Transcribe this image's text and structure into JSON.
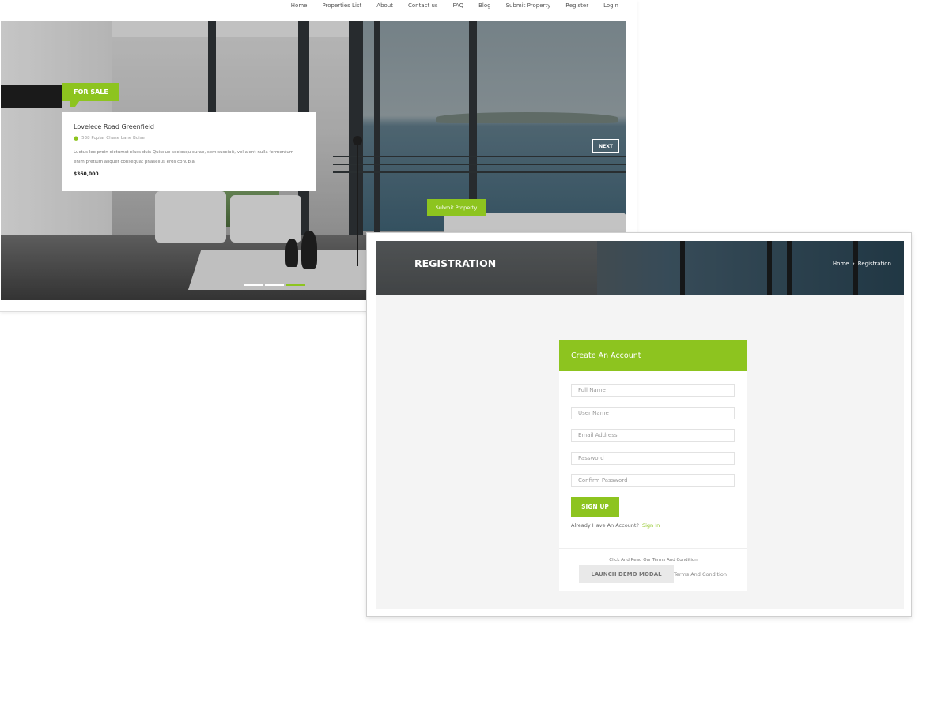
{
  "home": {
    "nav": [
      "Home",
      "Properties List",
      "About",
      "Contact us",
      "FAQ",
      "Blog",
      "Submit Property",
      "Register",
      "Login"
    ],
    "tag": "FOR SALE",
    "property": {
      "title": "Lovelece Road Greenfield",
      "address": "538 Poplar Chase Lane Boise",
      "description": "Luctus leo proin dictumst class duis Quisque sociosqu curae, sem suscipit, vel alent nulla fermentum enim pretium aliquet consequat phasellus eros conubia.",
      "price": "$360,000"
    },
    "next_label": "NEXT",
    "submit_label": "Submit Property",
    "slider": {
      "count": 3,
      "active": 3
    }
  },
  "registration": {
    "title": "REGISTRATION",
    "breadcrumb": {
      "home": "Home",
      "separator": "›",
      "current": "Registration"
    },
    "card_title": "Create An Account",
    "fields": {
      "full_name": "Full Name",
      "user_name": "User Name",
      "email": "Email Address",
      "password": "Password",
      "confirm_password": "Confirm Password"
    },
    "signup_label": "SIGN UP",
    "already_text": "Already Have An Account?",
    "signin_label": "Sign In",
    "terms_note": "Click And Read Our Terms And Condition",
    "demo_label": "LAUNCH DEMO MODAL",
    "terms_label": "Terms And Condition"
  },
  "colors": {
    "accent": "#8dc41f",
    "background": "#f4f4f4"
  }
}
